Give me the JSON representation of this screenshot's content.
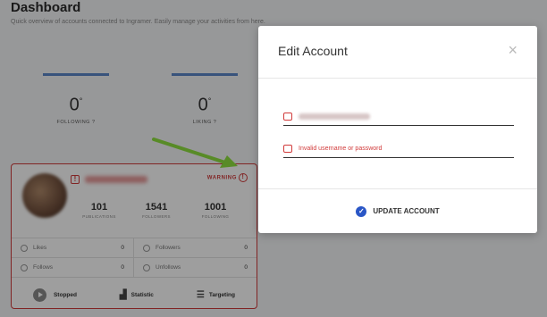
{
  "dashboard": {
    "title": "Dashboard",
    "subtitle": "Quick overview of accounts connected to Ingramer. Easily manage your activities from here."
  },
  "stats": [
    {
      "value": "0",
      "label": "FOLLOWING ?"
    },
    {
      "value": "0",
      "label": "LIKING ?"
    }
  ],
  "account_card": {
    "warning_label": "WARNING",
    "metrics": [
      {
        "value": "101",
        "label": "PUBLICATIONS"
      },
      {
        "value": "1541",
        "label": "FOLLOWERS"
      },
      {
        "value": "1001",
        "label": "FOLLOWING"
      }
    ],
    "rows": [
      {
        "left_label": "Likes",
        "left_value": "0",
        "right_label": "Followers",
        "right_value": "0"
      },
      {
        "left_label": "Follows",
        "left_value": "0",
        "right_label": "Unfollows",
        "right_value": "0"
      }
    ],
    "actions": {
      "stopped": "Stopped",
      "statistic": "Statistic",
      "targeting": "Targeting"
    }
  },
  "modal": {
    "title": "Edit Account",
    "close": "×",
    "password_error": "Invalid username or password",
    "update_label": "UPDATE ACCOUNT"
  },
  "colors": {
    "accent": "#2a56c6",
    "error": "#d13a3a",
    "arrow": "#8fe040"
  }
}
